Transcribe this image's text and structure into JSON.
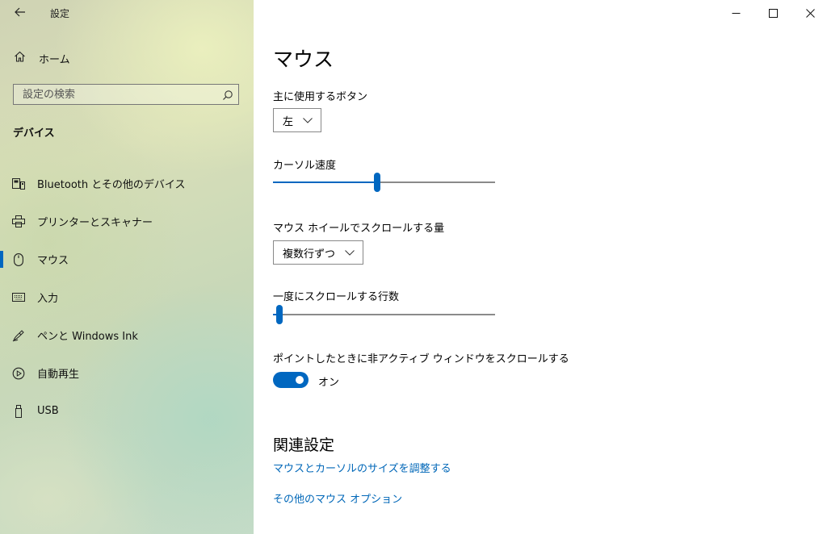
{
  "window": {
    "title": "設定",
    "controls": {
      "minimize": "–",
      "maximize": "□",
      "close": "✕"
    }
  },
  "sidebar": {
    "back_icon": "back-arrow-icon",
    "home": {
      "label": "ホーム",
      "icon": "home-icon"
    },
    "search": {
      "placeholder": "設定の検索",
      "value": "",
      "icon": "search-icon"
    },
    "section_title": "デバイス",
    "items": [
      {
        "label": "Bluetooth とその他のデバイス",
        "icon": "bluetooth-devices-icon",
        "active": false
      },
      {
        "label": "プリンターとスキャナー",
        "icon": "printer-icon",
        "active": false
      },
      {
        "label": "マウス",
        "icon": "mouse-icon",
        "active": true
      },
      {
        "label": "入力",
        "icon": "keyboard-icon",
        "active": false
      },
      {
        "label": "ペンと Windows Ink",
        "icon": "pen-icon",
        "active": false
      },
      {
        "label": "自動再生",
        "icon": "autoplay-icon",
        "active": false
      },
      {
        "label": "USB",
        "icon": "usb-icon",
        "active": false
      }
    ]
  },
  "main": {
    "title": "マウス",
    "primary_button": {
      "label": "主に使用するボタン",
      "value": "左"
    },
    "cursor_speed": {
      "label": "カーソル速度",
      "value": 0.47
    },
    "scroll_amount": {
      "label": "マウス ホイールでスクロールする量",
      "value": "複数行ずつ"
    },
    "scroll_lines": {
      "label": "一度にスクロールする行数",
      "value": 0.03
    },
    "inactive_scroll": {
      "label": "ポイントしたときに非アクティブ ウィンドウをスクロールする",
      "state": "オン",
      "on": true
    },
    "related": {
      "title": "関連設定",
      "links": [
        "マウスとカーソルのサイズを調整する",
        "その他のマウス オプション"
      ]
    }
  },
  "colors": {
    "accent": "#0067c0",
    "link": "#0067b8"
  }
}
